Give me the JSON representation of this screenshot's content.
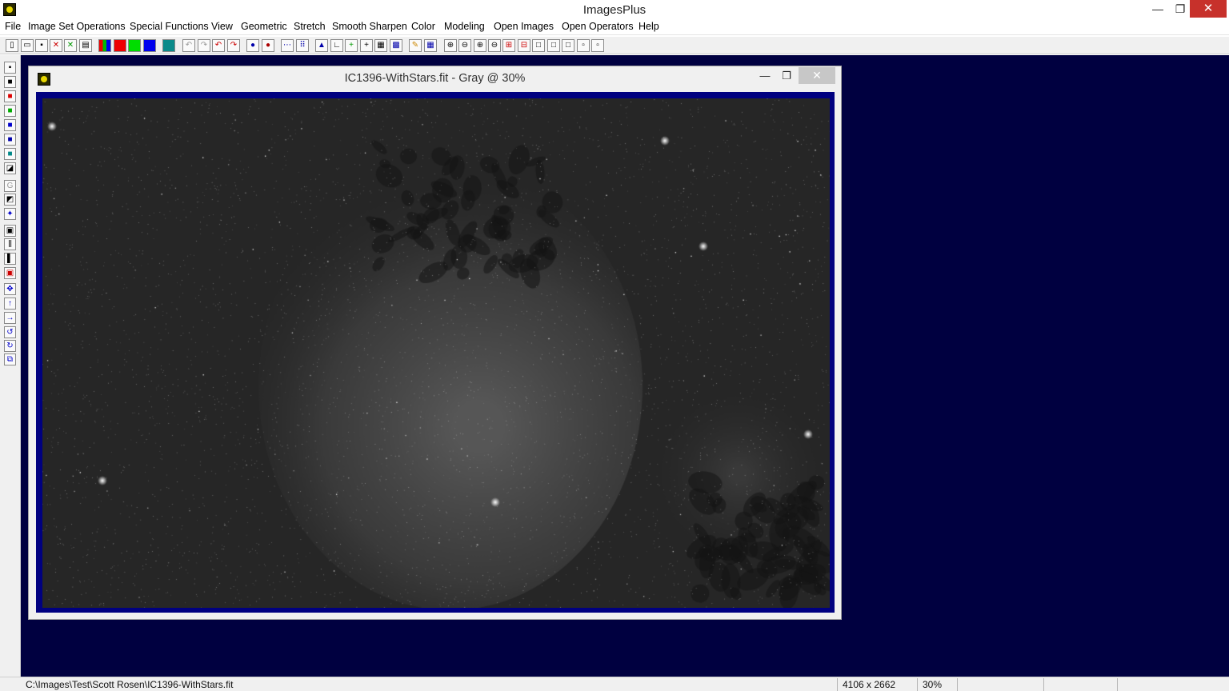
{
  "window": {
    "title": "ImagesPlus",
    "minimize_glyph": "—",
    "maximize_glyph": "❐",
    "close_glyph": "✕"
  },
  "menu": {
    "items": [
      "File",
      "Image Set Operations",
      "Special Functions",
      "View",
      "Geometric",
      "Stretch",
      "Smooth Sharpen",
      "Color",
      "Modeling",
      "Open Images",
      "Open Operators",
      "Help"
    ]
  },
  "document": {
    "title": "IC1396-WithStars.fit - Gray @ 30%",
    "minimize_glyph": "—",
    "maximize_glyph": "❐",
    "close_glyph": "✕"
  },
  "status": {
    "path": "C:\\Images\\Test\\Scott Rosen\\IC1396-WithStars.fit",
    "dimensions": "4106 x 2662",
    "zoom": "30%"
  },
  "colors": {
    "workspace": "#000040",
    "image_frame": "#000080",
    "close_button": "#c7312b"
  }
}
